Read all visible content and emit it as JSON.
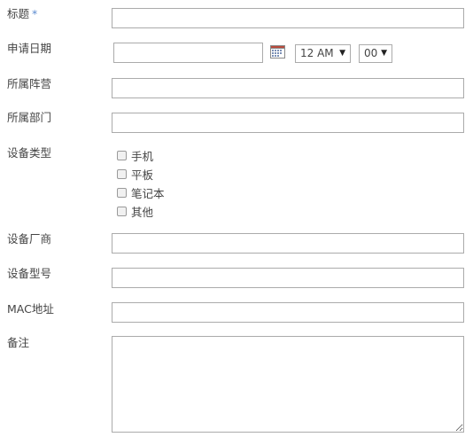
{
  "form": {
    "title": {
      "label": "标题",
      "required_mark": "*",
      "value": ""
    },
    "apply_date": {
      "label": "申请日期",
      "date_value": "",
      "hour": "12 AM",
      "minute": "00"
    },
    "camp": {
      "label": "所属阵营",
      "value": ""
    },
    "department": {
      "label": "所属部门",
      "value": ""
    },
    "device_type": {
      "label": "设备类型",
      "options": [
        "手机",
        "平板",
        "笔记本",
        "其他"
      ]
    },
    "vendor": {
      "label": "设备厂商",
      "value": ""
    },
    "model": {
      "label": "设备型号",
      "value": ""
    },
    "mac": {
      "label": "MAC地址",
      "value": ""
    },
    "remark": {
      "label": "备注",
      "value": ""
    }
  }
}
